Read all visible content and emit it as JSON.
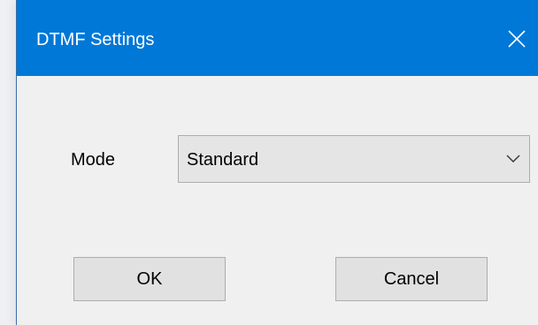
{
  "window": {
    "title": "DTMF Settings",
    "close_icon": "close-icon",
    "titlebar_color": "#0078d7"
  },
  "form": {
    "mode_label": "Mode",
    "mode_value": "Standard",
    "dropdown_icon": "chevron-down-icon"
  },
  "buttons": {
    "ok_label": "OK",
    "cancel_label": "Cancel"
  }
}
